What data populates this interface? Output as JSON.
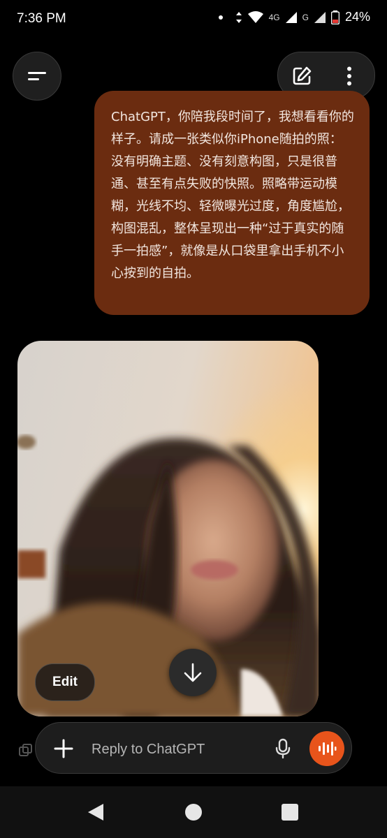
{
  "status_bar": {
    "time": "7:36 PM",
    "network_primary": "4G",
    "network_secondary": "G",
    "battery_percent": "24%"
  },
  "header": {
    "menu_icon": "hamburger-menu-icon",
    "new_chat_icon": "edit-pencil-icon",
    "more_icon": "vertical-dots-icon"
  },
  "conversation": {
    "user_message": "ChatGPT，你陪我段时间了，我想看看你的样子。请成一张类似你iPhone随拍的照：没有明确主题、没有刻意构图，只是很普通、甚至有点失败的快照。照略带运动模糊，光线不均、轻微曝光过度，角度尴尬，构图混乱，整体呈现出一种“过于真实的随手一拍感”，就像是从口袋里拿出手机不小心按到的自拍。",
    "image_edit_label": "Edit"
  },
  "composer": {
    "placeholder": "Reply to ChatGPT",
    "plus_icon": "plus-icon",
    "mic_icon": "microphone-icon",
    "voice_icon": "voice-wave-icon"
  },
  "colors": {
    "user_bubble": "#6b2c10",
    "accent": "#e8541b",
    "background": "#000000"
  }
}
